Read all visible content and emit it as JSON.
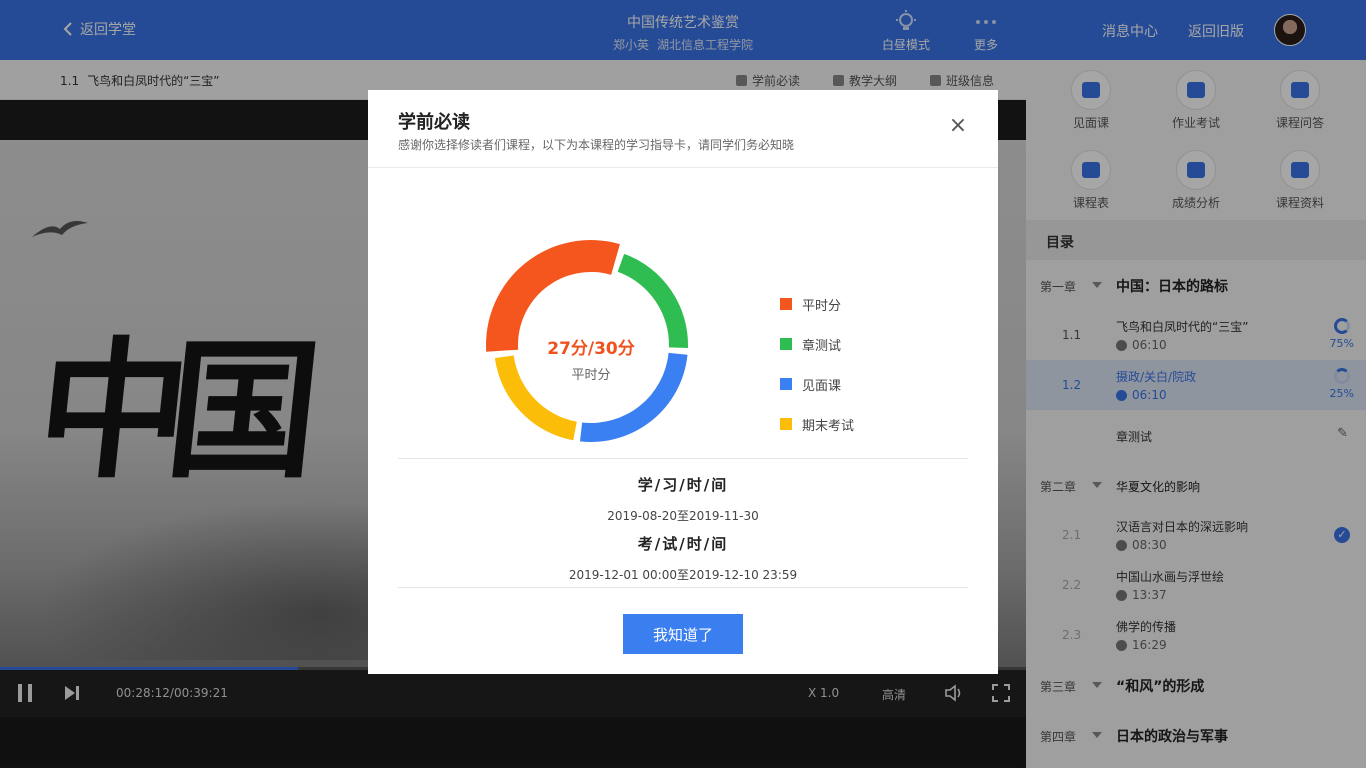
{
  "header": {
    "back_label": "返回学堂",
    "course_title": "中国传统艺术鉴赏",
    "teacher": "郑小英",
    "school": "湖北信息工程学院",
    "mode_label": "白昼模式",
    "more_label": "更多",
    "message_center": "消息中心",
    "old_version": "返回旧版",
    "icons": {
      "back": "chevron-left-icon",
      "mode": "bulb-icon",
      "more": "ellipsis-icon"
    }
  },
  "lesson_bar": {
    "number": "1.1",
    "title": "飞鸟和白凤时代的“三宝”",
    "tabs": [
      {
        "label": "学前必读"
      },
      {
        "label": "教学大纲"
      },
      {
        "label": "班级信息"
      }
    ]
  },
  "video": {
    "time": "00:28:12/00:39:21",
    "speed": "X 1.0",
    "quality": "高清",
    "calligraphy": "中国",
    "progress": 0.29
  },
  "right_panel": {
    "grid": [
      {
        "label": "见面课"
      },
      {
        "label": "作业考试"
      },
      {
        "label": "课程问答"
      },
      {
        "label": "课程表"
      },
      {
        "label": "成绩分析"
      },
      {
        "label": "课程资料"
      }
    ],
    "toc_title": "目录",
    "ch1": {
      "num": "第一章",
      "title": "中国：日本的路标"
    },
    "l11": {
      "num": "1.1",
      "title": "飞鸟和白凤时代的“三宝”",
      "duration": "06:10",
      "percent": "75%"
    },
    "l12": {
      "num": "1.2",
      "title": "摄政/关白/院政",
      "duration": "06:10",
      "percent": "25%"
    },
    "quiz": {
      "title": "章测试"
    },
    "ch2": {
      "num": "第二章",
      "title": "华夏文化的影响"
    },
    "l21": {
      "num": "2.1",
      "title": "汉语言对日本的深远影响",
      "duration": "08:30"
    },
    "l22": {
      "num": "2.2",
      "title": "中国山水画与浮世绘",
      "duration": "13:37"
    },
    "l23": {
      "num": "2.3",
      "title": "佛学的传播",
      "duration": "16:29"
    },
    "ch3": {
      "num": "第三章",
      "title": "“和风”的形成"
    },
    "ch4": {
      "num": "第四章",
      "title": "日本的政治与军事"
    }
  },
  "modal": {
    "title": "学前必读",
    "subtitle": "感谢你选择修读者们课程，以下为本课程的学习指导卡，请同学们务必知晓",
    "center_score": "27分/30分",
    "center_label": "平时分",
    "study_time_label": "学/习/时/间",
    "study_time_value": "2019-08-20至2019-11-30",
    "exam_time_label": "考/试/时/间",
    "exam_time_value": "2019-12-01 00:00至2019-12-10 23:59",
    "ok_label": "我知道了"
  },
  "chart_data": {
    "type": "pie",
    "categories": [
      "平时分",
      "章测试",
      "见面课",
      "期末考试"
    ],
    "values": [
      30,
      20,
      25,
      20
    ],
    "colors": [
      "#f5561d",
      "#2fbc50",
      "#3a80f2",
      "#fbbd08"
    ]
  }
}
